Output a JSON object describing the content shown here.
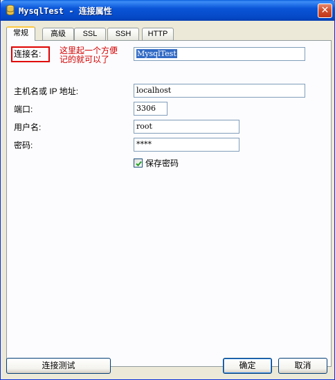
{
  "window": {
    "title": "MysqlTest - 连接属性",
    "close_glyph": "✕"
  },
  "tabs": [
    {
      "label": "常规",
      "active": true
    },
    {
      "label": "高级",
      "active": false
    },
    {
      "label": "SSL",
      "active": false
    },
    {
      "label": "SSH",
      "active": false
    },
    {
      "label": "HTTP",
      "active": false
    }
  ],
  "form": {
    "connection_name_label": "连接名:",
    "connection_name_value": "MysqlTest",
    "annotation_line1": "这里起一个方便",
    "annotation_line2": "记的就可以了",
    "host_label": "主机名或 IP 地址:",
    "host_value": "localhost",
    "port_label": "端口:",
    "port_value": "3306",
    "username_label": "用户名:",
    "username_value": "root",
    "password_label": "密码:",
    "password_value": "****",
    "save_password_label": "保存密码",
    "save_password_checked": true
  },
  "buttons": {
    "test_connection": "连接测试",
    "ok": "确定",
    "cancel": "取消"
  },
  "colors": {
    "annotation_red": "#d40000",
    "highlight_box": "#e00000",
    "selection_blue": "#316ac5"
  }
}
